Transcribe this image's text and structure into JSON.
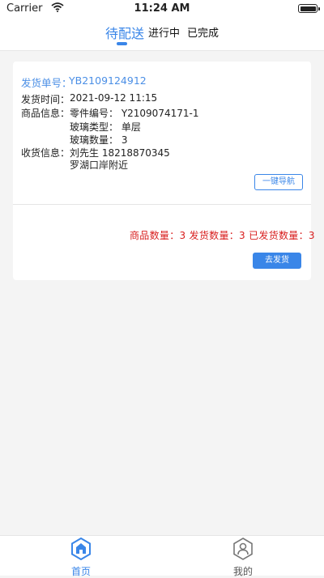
{
  "status_bar": {
    "carrier": "Carrier",
    "time": "11:24 AM"
  },
  "tabs": [
    {
      "label": "待配送",
      "active": true
    },
    {
      "label": "进行中",
      "active": false
    },
    {
      "label": "已完成",
      "active": false
    }
  ],
  "order": {
    "order_no_label": "发货单号：",
    "order_no": "YB2109124912",
    "ship_time_label": "发货时间：",
    "ship_time": "2021-09-12 11:15",
    "goods_label": "商品信息：",
    "part_no": "零件编号： Y2109074171-1",
    "glass_type": "玻璃类型： 单层",
    "glass_qty": "玻璃数量： 3",
    "receiver_label": "收货信息：",
    "receiver": "刘先生   18218870345",
    "address": "罗湖口岸附近",
    "nav_button": "一键导航",
    "counts": "商品数量：3 发货数量：3 已发货数量：3",
    "ship_button": "去发货"
  },
  "bottom_nav": [
    {
      "label": "首页",
      "icon": "home-icon",
      "active": true
    },
    {
      "label": "我的",
      "icon": "user-icon",
      "active": false
    }
  ],
  "colors": {
    "accent": "#3a86e8",
    "alert": "#d81e1e"
  }
}
